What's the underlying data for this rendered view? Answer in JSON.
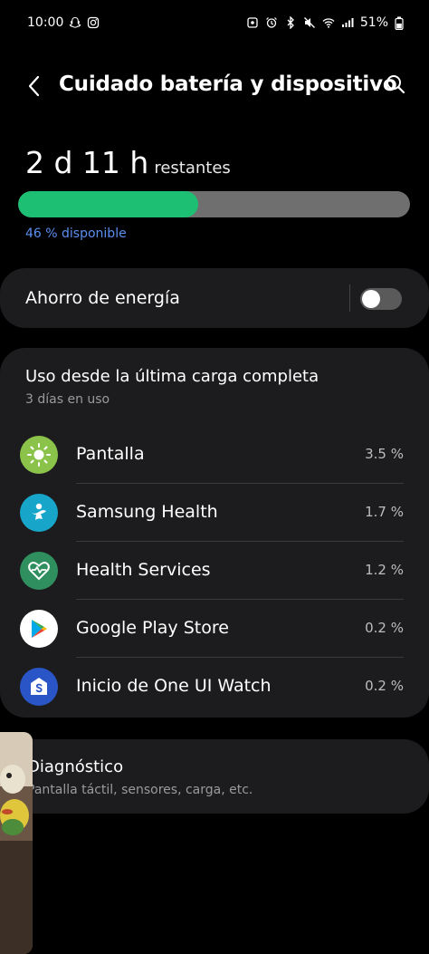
{
  "status_bar": {
    "time": "10:00",
    "battery_percent": "51%"
  },
  "header": {
    "title": "Cuidado batería y dispositivo"
  },
  "battery": {
    "remaining_time": "2 d 11 h",
    "remaining_suffix": "restantes",
    "level": 0.46,
    "available_text": "46 % disponible",
    "fill_color": "#1dbf73",
    "track_color": "#6f6f6f"
  },
  "power_saving": {
    "label": "Ahorro de energía",
    "enabled": false
  },
  "usage": {
    "title": "Uso desde la última carga completa",
    "subtitle": "3 días en uso",
    "apps": [
      {
        "name": "Pantalla",
        "percent": "3.5 %",
        "icon": "display-brightness-icon",
        "icon_color": "#8bc34a"
      },
      {
        "name": "Samsung Health",
        "percent": "1.7 %",
        "icon": "samsung-health-icon",
        "icon_color": "#17a6c9"
      },
      {
        "name": "Health Services",
        "percent": "1.2 %",
        "icon": "health-services-icon",
        "icon_color": "#2f8f5f"
      },
      {
        "name": "Google Play Store",
        "percent": "0.2 %",
        "icon": "google-play-icon",
        "icon_color": "#ffffff"
      },
      {
        "name": "Inicio de One UI Watch",
        "percent": "0.2 %",
        "icon": "one-ui-watch-icon",
        "icon_color": "#2a55c7"
      }
    ]
  },
  "diagnostics": {
    "title": "Diagnóstico",
    "subtitle": "Pantalla táctil, sensores, carga, etc."
  }
}
